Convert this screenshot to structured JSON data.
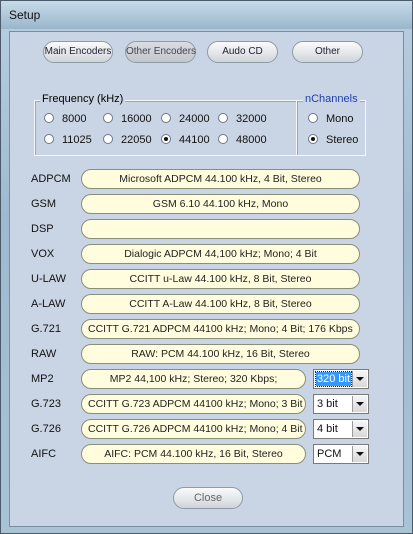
{
  "window": {
    "title": "Setup"
  },
  "tabs": [
    {
      "label": "Main Encoders",
      "active": false
    },
    {
      "label": "Other Encoders",
      "active": true
    },
    {
      "label": "Audo CD",
      "active": false
    },
    {
      "label": "Other",
      "active": false
    }
  ],
  "frequency": {
    "legend": "Frequency (kHz)",
    "options": [
      "8000",
      "16000",
      "24000",
      "32000",
      "11025",
      "22050",
      "44100",
      "48000"
    ],
    "selected": "44100"
  },
  "nchannels": {
    "legend": "nChannels",
    "options": [
      "Mono",
      "Stereo"
    ],
    "selected": "Stereo"
  },
  "encoders": [
    {
      "label": "ADPCM",
      "value": "Microsoft ADPCM 44.100 kHz, 4 Bit, Stereo"
    },
    {
      "label": "GSM",
      "value": "GSM 6.10 44.100 kHz, Mono"
    },
    {
      "label": "DSP",
      "value": ""
    },
    {
      "label": "VOX",
      "value": "Dialogic ADPCM 44,100 kHz; Mono; 4 Bit"
    },
    {
      "label": "U-LAW",
      "value": "CCITT u-Law 44.100 kHz, 8 Bit, Stereo"
    },
    {
      "label": "A-LAW",
      "value": "CCITT A-Law 44.100 kHz, 8 Bit, Stereo"
    },
    {
      "label": "G.721",
      "value": "CCITT G.721 ADPCM 44100 kHz; Mono; 4 Bit; 176 Kbps"
    },
    {
      "label": "RAW",
      "value": "RAW: PCM 44.100 kHz, 16 Bit, Stereo"
    },
    {
      "label": "MP2",
      "value": "MP2 44,100 kHz; Stereo;  320 Kbps;",
      "option": "320 bit"
    },
    {
      "label": "G.723",
      "value": "CCITT G.723 ADPCM 44100 kHz; Mono; 3 Bit",
      "option": "3 bit"
    },
    {
      "label": "G.726",
      "value": "CCITT G.726 ADPCM 44100 kHz; Mono; 4 Bit",
      "option": "4 bit"
    },
    {
      "label": "AIFC",
      "value": "AIFC:  PCM 44.100 kHz, 16 Bit, Stereo",
      "option": "PCM"
    }
  ],
  "close_label": "Close"
}
